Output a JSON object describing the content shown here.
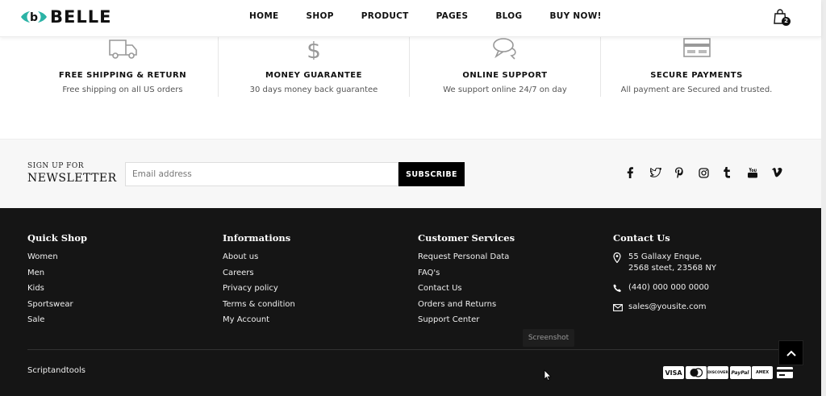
{
  "brand": {
    "name": "BELLE",
    "accent": "#2bb3a6"
  },
  "nav": [
    "HOME",
    "SHOP",
    "PRODUCT",
    "PAGES",
    "BLOG",
    "BUY NOW!"
  ],
  "cart": {
    "count": "2",
    "icon": "shopping-bag-icon"
  },
  "features": [
    {
      "icon": "truck-icon",
      "title": "FREE SHIPPING & RETURN",
      "desc": "Free shipping on all US orders"
    },
    {
      "icon": "dollar-icon",
      "title": "MONEY GUARANTEE",
      "desc": "30 days money back guarantee"
    },
    {
      "icon": "chat-bubbles-icon",
      "title": "ONLINE SUPPORT",
      "desc": "We support online 24/7 on day"
    },
    {
      "icon": "credit-card-icon",
      "title": "SECURE PAYMENTS",
      "desc": "All payment are Secured and trusted."
    }
  ],
  "newsletter": {
    "small": "SIGN UP FOR",
    "big": "NEWSLETTER",
    "placeholder": "Email address",
    "button": "SUBSCRIBE"
  },
  "social": [
    "facebook-icon",
    "twitter-icon",
    "pinterest-icon",
    "instagram-icon",
    "tumblr-icon",
    "youtube-icon",
    "vimeo-icon"
  ],
  "footer": {
    "quick_shop": {
      "title": "Quick Shop",
      "items": [
        "Women",
        "Men",
        "Kids",
        "Sportswear",
        "Sale"
      ]
    },
    "informations": {
      "title": "Informations",
      "items": [
        "About us",
        "Careers",
        "Privacy policy",
        "Terms & condition",
        "My Account"
      ]
    },
    "customer_services": {
      "title": "Customer Services",
      "items": [
        "Request Personal Data",
        "FAQ's",
        "Contact Us",
        "Orders and Returns",
        "Support Center"
      ]
    },
    "contact": {
      "title": "Contact Us",
      "address_line1": "55 Gallaxy Enque,",
      "address_line2": "2568 steet, 23568 NY",
      "phone": "(440) 000 000 0000",
      "email": "sales@yousite.com"
    },
    "copyright": "Scriptandtools",
    "payments": [
      "VISA",
      "MC",
      "DISCOVER",
      "PayPal",
      "AMEX",
      "CARD"
    ]
  },
  "tooltip": "Screenshot"
}
